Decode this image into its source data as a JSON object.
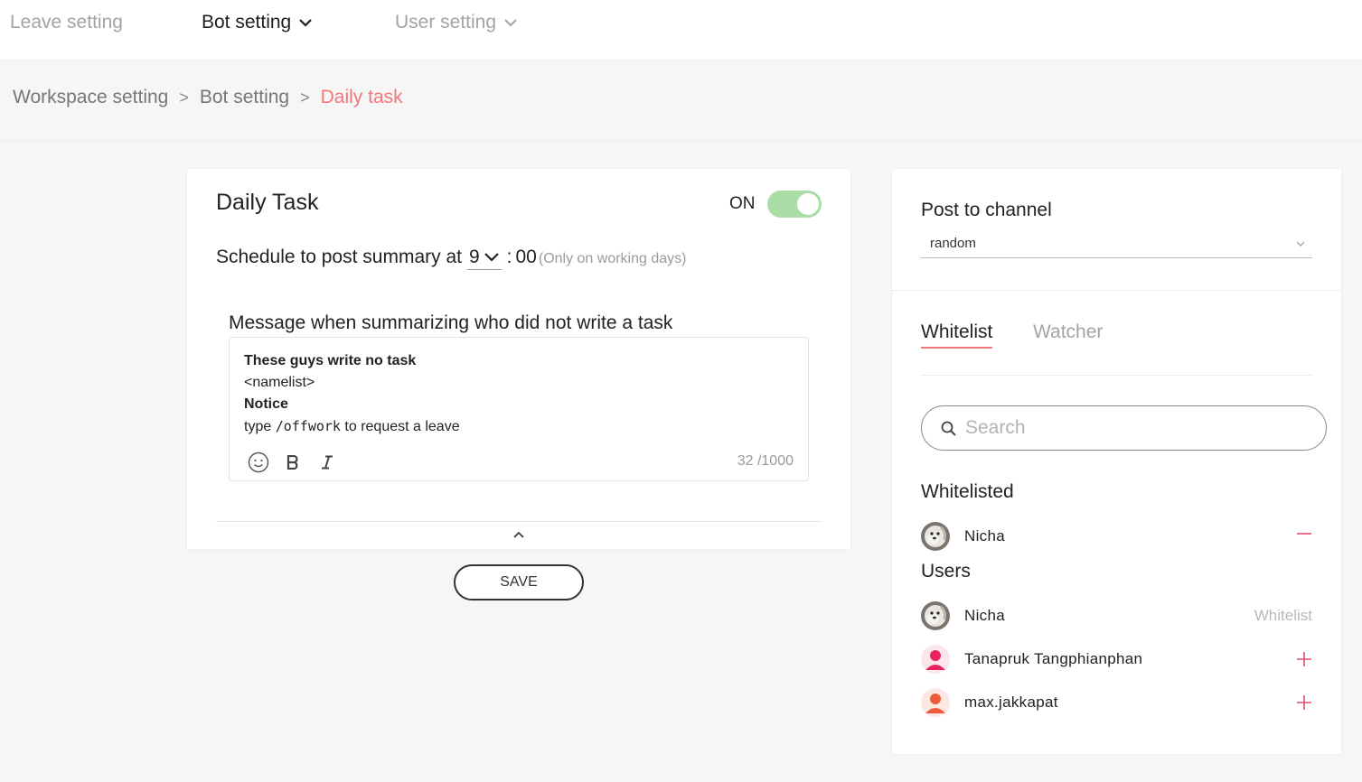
{
  "nav": {
    "items": [
      {
        "label": "Leave setting"
      },
      {
        "label": "Bot setting"
      },
      {
        "label": "User setting"
      }
    ]
  },
  "breadcrumb": {
    "items": [
      "Workspace setting",
      "Bot setting",
      "Daily task"
    ],
    "separator": ">"
  },
  "daily_task": {
    "title": "Daily Task",
    "toggle_label": "ON",
    "toggle_on": true,
    "schedule_prefix": "Schedule to post summary at",
    "hour": "9",
    "minute": "00",
    "schedule_note": "(Only on working days)",
    "message_label": "Message when summarizing who did not write a task",
    "message": {
      "line1": "These guys write no task",
      "line2": "<namelist>",
      "line3": "Notice",
      "line4_prefix": "type",
      "line4_code": "/offwork",
      "line4_suffix": "to request a leave"
    },
    "counter": "32 /1000",
    "tools": [
      "emoji-icon",
      "bold-icon",
      "italic-icon"
    ],
    "save_label": "SAVE"
  },
  "right_panel": {
    "post_label": "Post to channel",
    "channel_value": "random",
    "tabs": [
      "Whitelist",
      "Watcher"
    ],
    "search_placeholder": "Search",
    "whitelisted_title": "Whitelisted",
    "whitelisted": [
      {
        "name": "Nicha",
        "avatar": "photo"
      }
    ],
    "users_title": "Users",
    "users": [
      {
        "name": "Nicha",
        "avatar": "photo",
        "action": "Whitelist"
      },
      {
        "name": "Tanapruk Tangphianphan",
        "avatar": "person-icon",
        "avatar_color": "#e8245f",
        "action": "plus-icon"
      },
      {
        "name": "max.jakkapat",
        "avatar": "person-icon",
        "avatar_color": "#ef5a3c",
        "action": "plus-icon"
      }
    ],
    "accent_color": "#e84a6f"
  },
  "colors": {
    "breadcrumb_current": "#f2777a",
    "toggle_on": "#a9dea7",
    "tab_underline": "#f2777a"
  }
}
